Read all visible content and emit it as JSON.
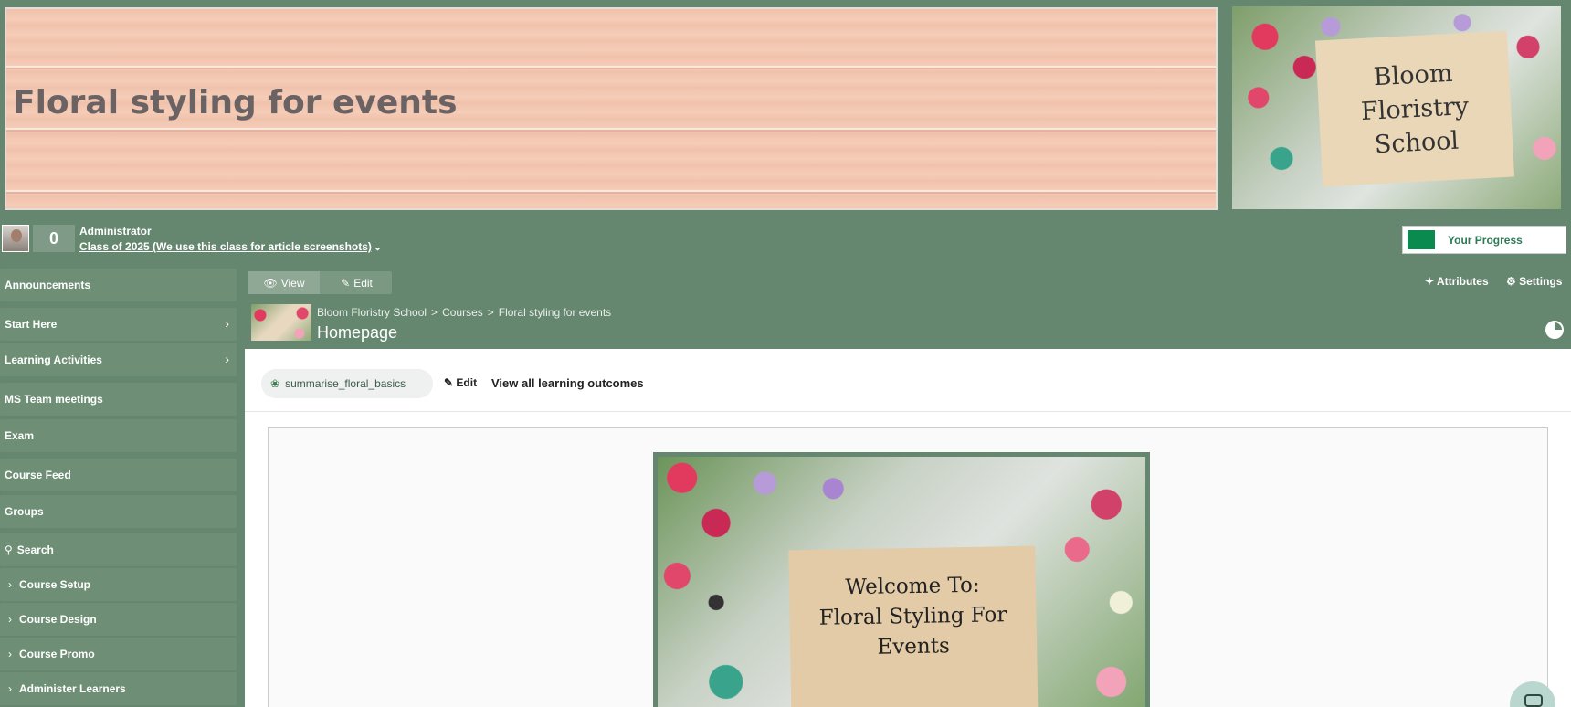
{
  "banner": {
    "title": "Floral styling for events",
    "logo_lines": [
      "Bloom",
      "Floristry",
      "School"
    ]
  },
  "user": {
    "points": "0",
    "role": "Administrator",
    "class_name": "Class of 2025 (We use this class for article screenshots)",
    "progress_label": "Your Progress"
  },
  "sidebar": {
    "items": [
      {
        "label": "Announcements"
      },
      {
        "label": "Start Here"
      },
      {
        "label": "Learning Activities"
      },
      {
        "label": "MS Team meetings"
      },
      {
        "label": "Exam"
      },
      {
        "label": "Course Feed"
      },
      {
        "label": "Groups"
      },
      {
        "label": "Search"
      },
      {
        "label": "Course Setup"
      },
      {
        "label": "Course Design"
      },
      {
        "label": "Course Promo"
      },
      {
        "label": "Administer Learners"
      }
    ]
  },
  "toolbar": {
    "view_label": "View",
    "edit_label": "Edit",
    "attributes_label": "Attributes",
    "settings_label": "Settings"
  },
  "breadcrumb": [
    "Bloom Floristry School",
    "Courses",
    "Floral styling for events"
  ],
  "page": {
    "title": "Homepage"
  },
  "outcomes": {
    "tag": "summarise_floral_basics",
    "edit_label": "Edit",
    "view_all_label": "View all learning outcomes"
  },
  "welcome": {
    "lines": [
      "Welcome To:",
      "Floral Styling For",
      "Events"
    ]
  },
  "colors": {
    "theme": "#65866f",
    "progress": "#0b8a4f"
  }
}
